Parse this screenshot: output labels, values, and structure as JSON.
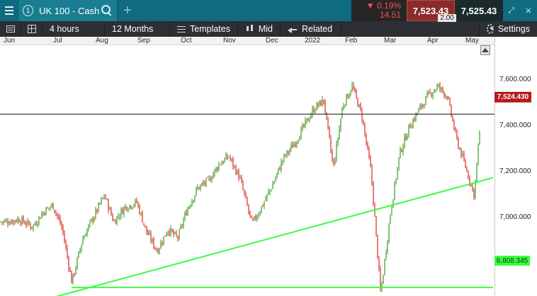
{
  "window": {
    "tab_number": "1",
    "instrument": "UK 100 - Cash",
    "change_pct": "▼ 0.19%",
    "change_abs": "14.51",
    "sell_price": "7,523.43",
    "buy_price": "7,525.43",
    "spread": "2.00",
    "add_tab_label": "+"
  },
  "toolbar": {
    "interval": "4 hours",
    "range": "12 Months",
    "templates": "Templates",
    "price_type": "Mid",
    "related": "Related",
    "settings": "Settings"
  },
  "chart_data": {
    "type": "candlestick",
    "colors": {
      "up": "#2e9e1f",
      "down": "#d9251c",
      "trendline": "#39ff3d",
      "current_line": "#111111"
    },
    "x_ticks": [
      "Jun",
      "Jul",
      "Aug",
      "Sep",
      "Oct",
      "Nov",
      "Dec",
      "2022",
      "Feb",
      "Mar",
      "Apr",
      "May"
    ],
    "y_ticks": [
      "7,600.000",
      "7,400.000",
      "7,200.000",
      "7,000.000"
    ],
    "ylim": [
      6760,
      7710
    ],
    "current_price": "7,524.430",
    "support_price": "6,808.345",
    "price_path": [
      [
        "2021-06-01",
        7080
      ],
      [
        "2021-06-10",
        7090
      ],
      [
        "2021-06-20",
        7060
      ],
      [
        "2021-06-28",
        7120
      ],
      [
        "2021-07-05",
        7150
      ],
      [
        "2021-07-12",
        7050
      ],
      [
        "2021-07-19",
        6830
      ],
      [
        "2021-07-27",
        7010
      ],
      [
        "2021-08-05",
        7110
      ],
      [
        "2021-08-12",
        7190
      ],
      [
        "2021-08-19",
        7080
      ],
      [
        "2021-08-27",
        7140
      ],
      [
        "2021-09-05",
        7160
      ],
      [
        "2021-09-12",
        7040
      ],
      [
        "2021-09-20",
        6960
      ],
      [
        "2021-09-28",
        7050
      ],
      [
        "2021-10-05",
        7010
      ],
      [
        "2021-10-12",
        7130
      ],
      [
        "2021-10-20",
        7220
      ],
      [
        "2021-10-28",
        7250
      ],
      [
        "2021-11-05",
        7320
      ],
      [
        "2021-11-12",
        7350
      ],
      [
        "2021-11-20",
        7260
      ],
      [
        "2021-11-29",
        7070
      ],
      [
        "2021-12-06",
        7140
      ],
      [
        "2021-12-14",
        7230
      ],
      [
        "2021-12-22",
        7340
      ],
      [
        "2021-12-31",
        7410
      ],
      [
        "2022-01-07",
        7480
      ],
      [
        "2022-01-14",
        7550
      ],
      [
        "2022-01-21",
        7580
      ],
      [
        "2022-01-28",
        7300
      ],
      [
        "2022-02-04",
        7560
      ],
      [
        "2022-02-11",
        7640
      ],
      [
        "2022-02-18",
        7520
      ],
      [
        "2022-02-25",
        7280
      ],
      [
        "2022-03-04",
        6780
      ],
      [
        "2022-03-11",
        7110
      ],
      [
        "2022-03-18",
        7360
      ],
      [
        "2022-03-25",
        7470
      ],
      [
        "2022-04-01",
        7540
      ],
      [
        "2022-04-08",
        7600
      ],
      [
        "2022-04-15",
        7640
      ],
      [
        "2022-04-22",
        7600
      ],
      [
        "2022-04-29",
        7420
      ],
      [
        "2022-05-06",
        7300
      ],
      [
        "2022-05-12",
        7190
      ],
      [
        "2022-05-17",
        7520
      ]
    ],
    "trendlines": [
      {
        "kind": "horizontal",
        "price": 6808.345,
        "from": "2021-07-19",
        "to": "2022-05-26"
      },
      {
        "kind": "diagonal",
        "from": [
          "2021-06-01",
          6715
        ],
        "to": [
          "2022-05-26",
          7262
        ]
      }
    ]
  }
}
